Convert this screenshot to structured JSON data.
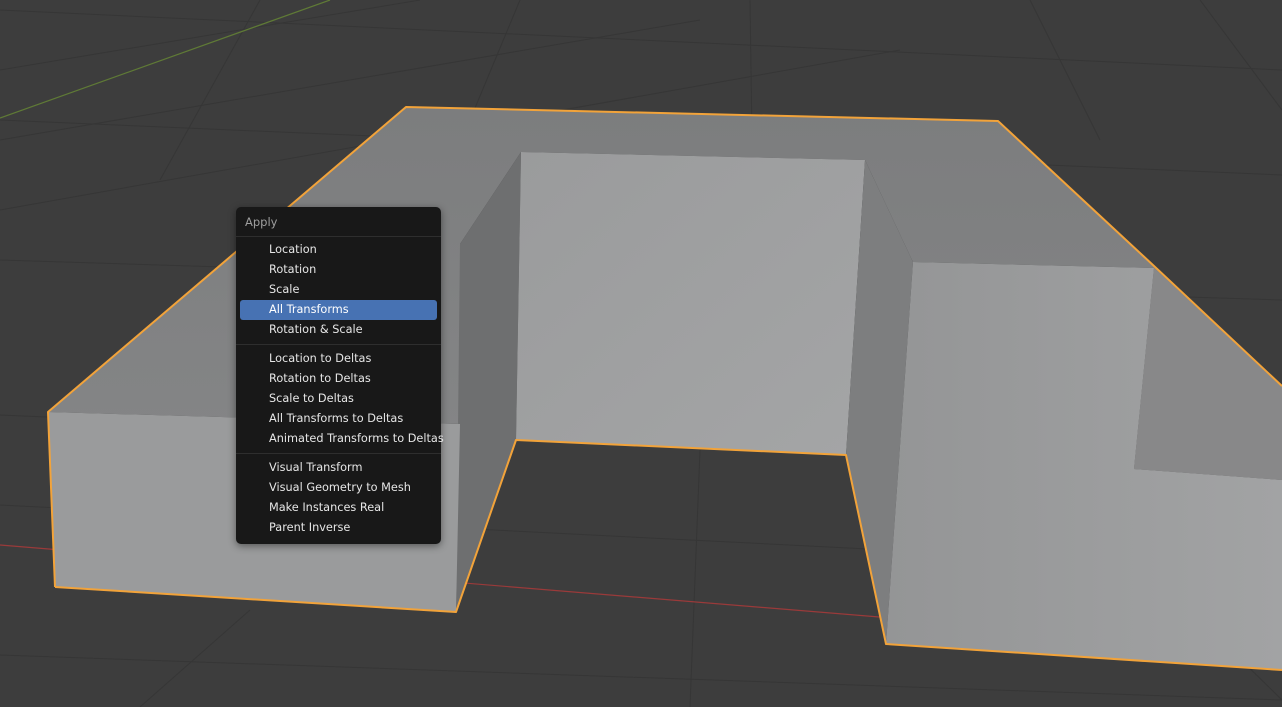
{
  "viewport": {
    "name": "3D Viewport",
    "background": "#3d3d3d",
    "object_color": "#8a8b8c",
    "selection_outline": "#f2a33a",
    "x_axis_color": "#9a3a3a",
    "y_axis_color": "#5f7a36"
  },
  "menu": {
    "title": "Apply",
    "active_color": "#4772b3",
    "groups": [
      [
        {
          "label": "Location",
          "name": "menu-item-location"
        },
        {
          "label": "Rotation",
          "name": "menu-item-rotation"
        },
        {
          "label": "Scale",
          "name": "menu-item-scale"
        },
        {
          "label": "All Transforms",
          "name": "menu-item-all-transforms",
          "active": true
        },
        {
          "label": "Rotation & Scale",
          "name": "menu-item-rotation-and-scale"
        }
      ],
      [
        {
          "label": "Location to Deltas",
          "name": "menu-item-location-to-deltas"
        },
        {
          "label": "Rotation to Deltas",
          "name": "menu-item-rotation-to-deltas"
        },
        {
          "label": "Scale to Deltas",
          "name": "menu-item-scale-to-deltas"
        },
        {
          "label": "All Transforms to Deltas",
          "name": "menu-item-all-transforms-to-deltas"
        },
        {
          "label": "Animated Transforms to Deltas",
          "name": "menu-item-animated-transforms-to-deltas"
        }
      ],
      [
        {
          "label": "Visual Transform",
          "name": "menu-item-visual-transform"
        },
        {
          "label": "Visual Geometry to Mesh",
          "name": "menu-item-visual-geometry-to-mesh"
        },
        {
          "label": "Make Instances Real",
          "name": "menu-item-make-instances-real"
        },
        {
          "label": "Parent Inverse",
          "name": "menu-item-parent-inverse"
        }
      ]
    ]
  }
}
